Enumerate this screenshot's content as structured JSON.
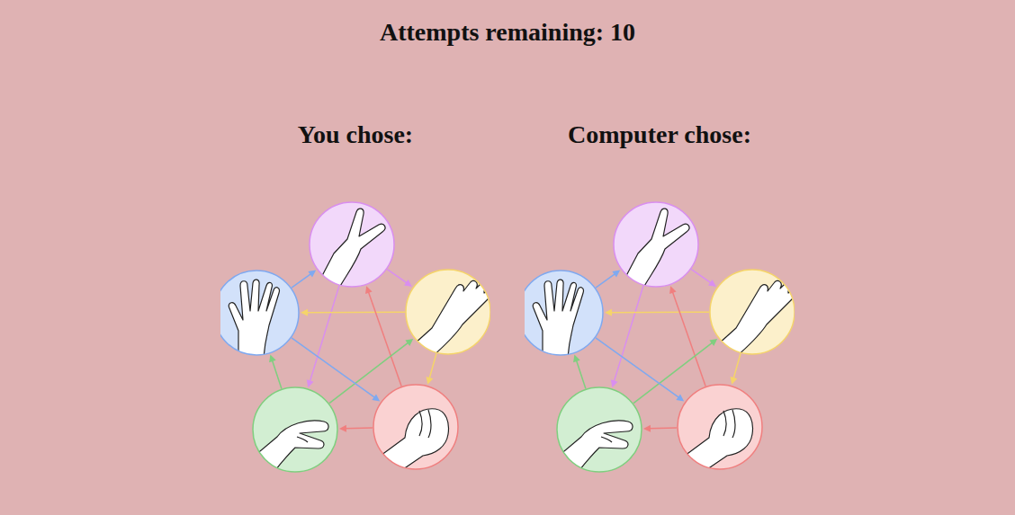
{
  "title": "Attempts remaining: 10",
  "players": [
    {
      "label": "You chose:",
      "choices": [
        {
          "kind": "scissors",
          "color": "#d98ef0",
          "selected": false,
          "beats": [
            "paper",
            "lizard"
          ]
        },
        {
          "kind": "paper",
          "color": "#f5d469",
          "selected": false,
          "beats": [
            "rock",
            "spock"
          ]
        },
        {
          "kind": "rock",
          "color": "#f07f7f",
          "selected": false,
          "beats": [
            "scissors",
            "lizard"
          ]
        },
        {
          "kind": "lizard",
          "color": "#7fcf7f",
          "selected": false,
          "beats": [
            "paper",
            "spock"
          ]
        },
        {
          "kind": "spock",
          "color": "#7fa9f0",
          "selected": false,
          "beats": [
            "scissors",
            "rock"
          ]
        }
      ]
    },
    {
      "label": "Computer chose:",
      "choices": [
        {
          "kind": "scissors",
          "color": "#d98ef0",
          "selected": false,
          "beats": [
            "paper",
            "lizard"
          ]
        },
        {
          "kind": "paper",
          "color": "#f5d469",
          "selected": false,
          "beats": [
            "rock",
            "spock"
          ]
        },
        {
          "kind": "rock",
          "color": "#f07f7f",
          "selected": false,
          "beats": [
            "scissors",
            "lizard"
          ]
        },
        {
          "kind": "lizard",
          "color": "#7fcf7f",
          "selected": false,
          "beats": [
            "paper",
            "spock"
          ]
        },
        {
          "kind": "spock",
          "color": "#7fa9f0",
          "selected": false,
          "beats": [
            "scissors",
            "rock"
          ]
        }
      ]
    }
  ]
}
